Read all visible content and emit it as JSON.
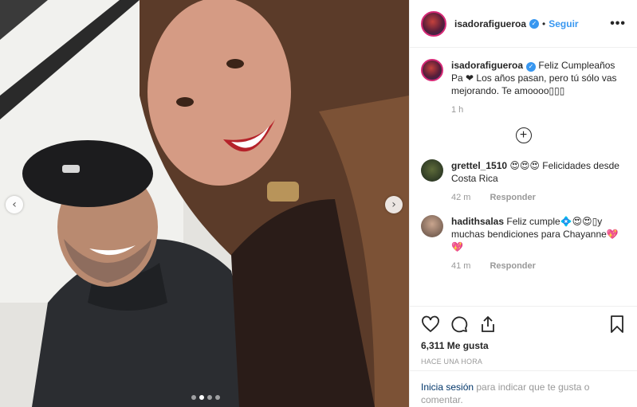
{
  "post": {
    "username": "isadorafigueroa",
    "verified_icon": "verified-badge-icon",
    "separator": "•",
    "follow_label": "Seguir",
    "more_label": "•••"
  },
  "caption": {
    "username": "isadorafigueroa",
    "text": "Feliz Cumpleaños Pa ❤ Los años pasan, pero tú sólo vas mejorando. Te amoooo▯▯▯",
    "time": "1 h"
  },
  "load_more_label": "+",
  "comments": [
    {
      "username": "grettel_1510",
      "text": "😍😍😍 Felicidades desde Costa Rica",
      "time": "42 m",
      "reply_label": "Responder"
    },
    {
      "username": "hadithsalas",
      "text": "Feliz cumple💠😍😍▯y muchas bendiciones para Chayanne💖💖",
      "time": "41 m",
      "reply_label": "Responder"
    }
  ],
  "engagement": {
    "likes": "6,311 Me gusta",
    "posted": "HACE UNA HORA"
  },
  "login": {
    "link": "Inicia sesión",
    "rest": " para indicar que te gusta o comentar."
  },
  "carousel": {
    "prev": "‹",
    "next": "›",
    "slides": 4,
    "active_slide": 2
  }
}
